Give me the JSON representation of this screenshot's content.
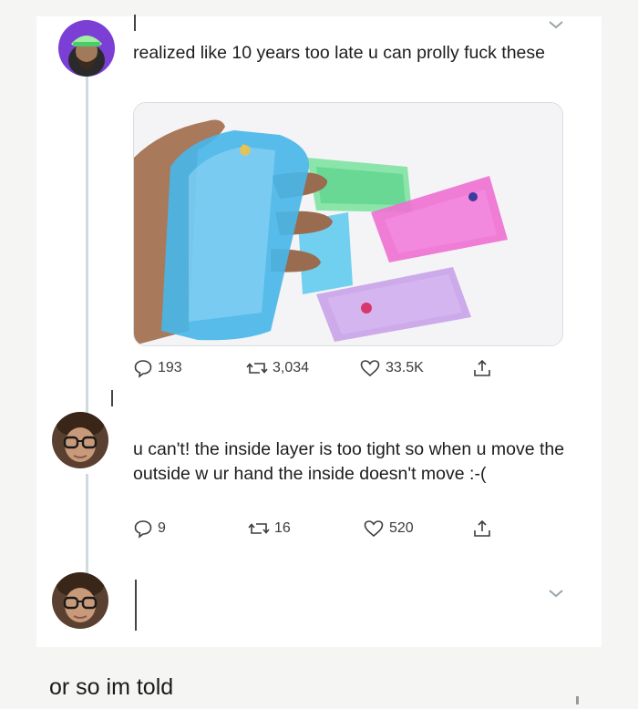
{
  "tweet1": {
    "text": "realized like 10 years too late u can prolly fuck these",
    "media_description_icon": "water-wiggler-toys-photo",
    "actions": {
      "reply_count": "193",
      "retweet_count": "3,034",
      "like_count": "33.5K"
    }
  },
  "tweet2": {
    "text": "u can't! the inside layer is too tight so when u move the outside w ur hand the inside doesn't move :-(",
    "actions": {
      "reply_count": "9",
      "retweet_count": "16",
      "like_count": "520"
    }
  },
  "tweet3": {
    "text": ""
  },
  "caption": "or so im told",
  "icons": {
    "reply": "speech-bubble-icon",
    "retweet": "retweet-arrows-icon",
    "like": "heart-icon",
    "share": "share-upload-icon",
    "more": "chevron-down-icon"
  },
  "colors": {
    "avatar1_bg": "#7b3fd6",
    "thread_line": "#cfd9de",
    "action_gray": "#3c3c3c"
  }
}
